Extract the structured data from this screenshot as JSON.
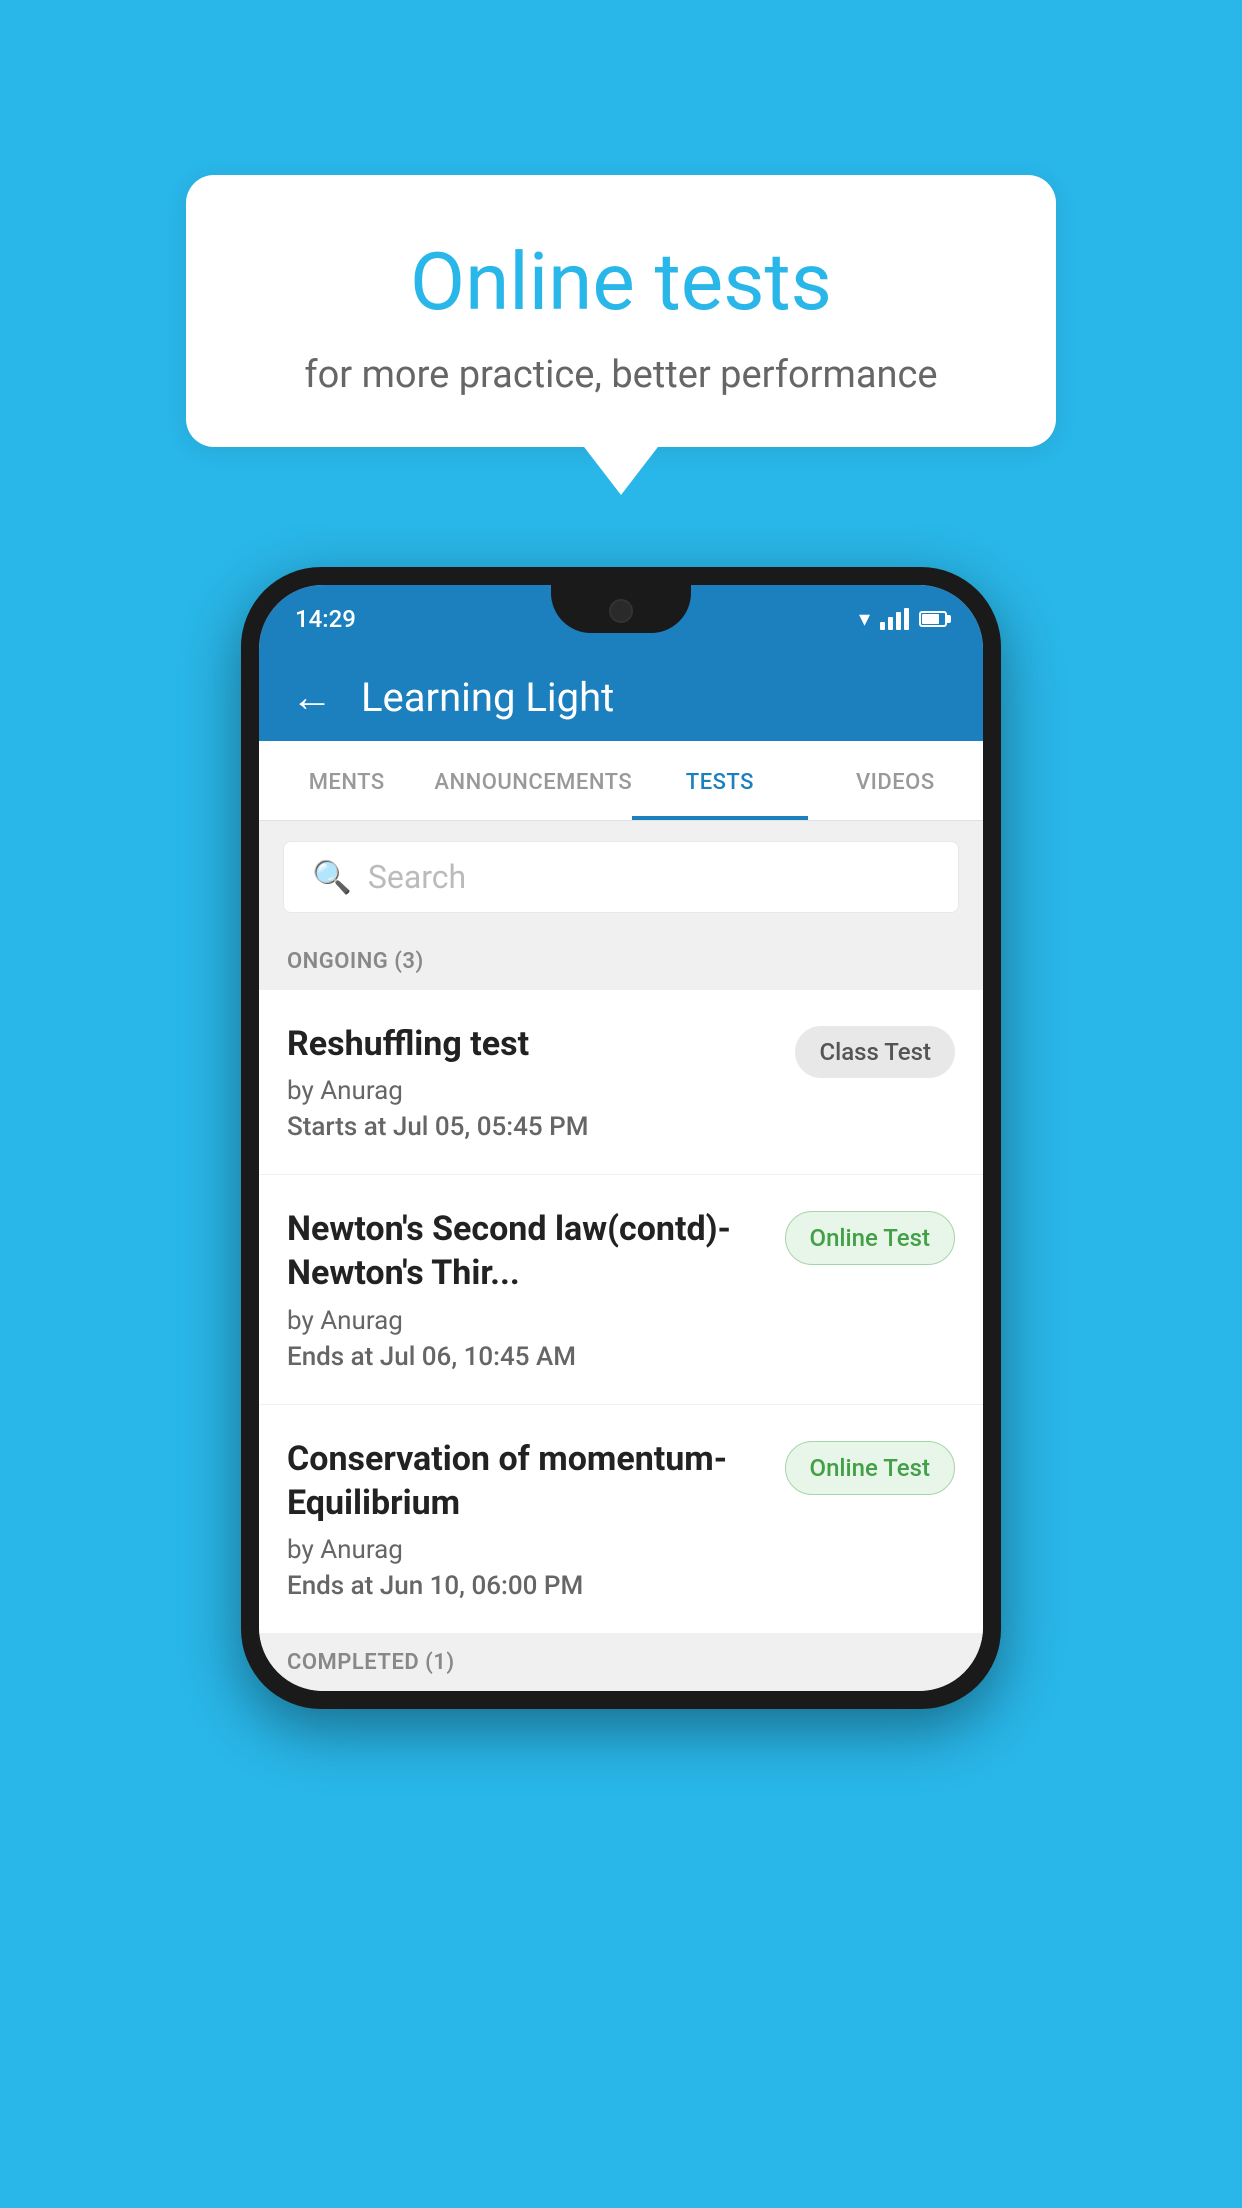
{
  "background_color": "#29b6e8",
  "bubble": {
    "title": "Online tests",
    "subtitle": "for more practice, better performance"
  },
  "phone": {
    "status_bar": {
      "time": "14:29"
    },
    "header": {
      "title": "Learning Light",
      "back_label": "←"
    },
    "tabs": [
      {
        "label": "MENTS",
        "active": false
      },
      {
        "label": "ANNOUNCEMENTS",
        "active": false
      },
      {
        "label": "TESTS",
        "active": true
      },
      {
        "label": "VIDEOS",
        "active": false
      }
    ],
    "search": {
      "placeholder": "Search"
    },
    "ongoing_section": {
      "label": "ONGOING (3)"
    },
    "tests": [
      {
        "name": "Reshuffling test",
        "by": "by Anurag",
        "time_label": "Starts at",
        "time_value": "Jul 05, 05:45 PM",
        "badge": "Class Test",
        "badge_type": "class"
      },
      {
        "name": "Newton's Second law(contd)-Newton's Thir...",
        "by": "by Anurag",
        "time_label": "Ends at",
        "time_value": "Jul 06, 10:45 AM",
        "badge": "Online Test",
        "badge_type": "online"
      },
      {
        "name": "Conservation of momentum-Equilibrium",
        "by": "by Anurag",
        "time_label": "Ends at",
        "time_value": "Jun 10, 06:00 PM",
        "badge": "Online Test",
        "badge_type": "online"
      }
    ],
    "completed_section": {
      "label": "COMPLETED (1)"
    }
  }
}
